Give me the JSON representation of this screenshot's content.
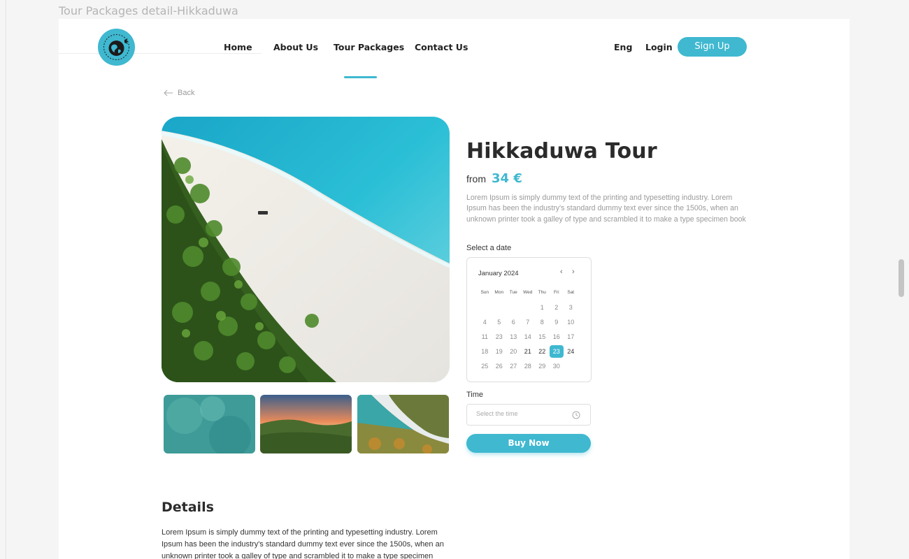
{
  "frame": {
    "title": "Tour Packages detail-Hikkaduwa"
  },
  "header": {
    "nav": [
      {
        "label": "Home"
      },
      {
        "label": "About Us"
      },
      {
        "label": "Tour Packages"
      },
      {
        "label": "Contact Us"
      }
    ],
    "language": "Eng",
    "login": "Login",
    "signup": "Sign Up",
    "active_nav": "Tour Packages"
  },
  "back_label": "Back",
  "tour": {
    "title": "Hikkaduwa Tour",
    "from_label": "from",
    "price": "34 €",
    "description": "Lorem Ipsum is simply dummy text of the printing and typesetting industry. Lorem Ipsum has been the industry's standard dummy text ever since the 1500s, when an unknown printer took a galley of type and scrambled it to make a type specimen book"
  },
  "date_picker": {
    "label": "Select a date",
    "month": "January 2024",
    "prev_icon": "chevron-left-icon",
    "next_icon": "chevron-right-icon",
    "weekdays": [
      "Sun",
      "Mon",
      "Tue",
      "Wed",
      "Thu",
      "Fri",
      "Sat"
    ],
    "weeks": [
      [
        "",
        "",
        "",
        "",
        "1",
        "2",
        "3"
      ],
      [
        "4",
        "5",
        "6",
        "7",
        "8",
        "9",
        "10"
      ],
      [
        "11",
        "23",
        "13",
        "14",
        "15",
        "16",
        "17"
      ],
      [
        "18",
        "19",
        "20",
        "21",
        "22",
        "23",
        "24"
      ],
      [
        "25",
        "26",
        "27",
        "28",
        "29",
        "30",
        ""
      ]
    ],
    "selected": "23",
    "dark_days": [
      "21",
      "22",
      "24"
    ]
  },
  "time": {
    "label": "Time",
    "placeholder": "Select the time",
    "icon": "clock-icon"
  },
  "buy_label": "Buy Now",
  "details": {
    "title": "Details",
    "text": "Lorem Ipsum is simply dummy text of the printing and typesetting industry. Lorem Ipsum has been the industry's standard dummy text ever since the 1500s, when an unknown printer took a galley of type and scrambled it to make a type specimen"
  },
  "colors": {
    "accent": "#3fb8d0",
    "text_dark": "#2b2b2b",
    "text_muted": "#9a9a9a"
  }
}
